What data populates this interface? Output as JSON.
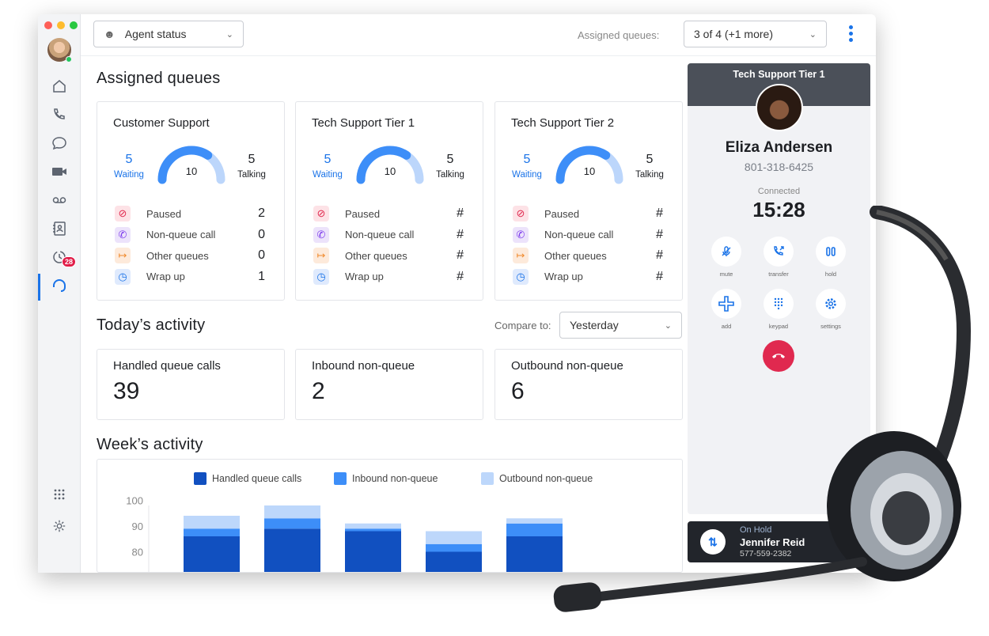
{
  "sidebar": {
    "items": [
      "home",
      "calls",
      "messages",
      "video",
      "voicemail",
      "contacts",
      "history",
      "queues"
    ],
    "history_badge": "28",
    "bottom": [
      "apps",
      "settings"
    ]
  },
  "header": {
    "agent_status": "Agent status",
    "assigned_label": "Assigned queues:",
    "assigned_value": "3 of 4 (+1 more)"
  },
  "assigned": {
    "title": "Assigned queues",
    "queues": [
      {
        "name": "Customer Support",
        "waiting": "5",
        "waiting_label": "Waiting",
        "total": "10",
        "talking": "5",
        "talking_label": "Talking",
        "rows": [
          {
            "label": "Paused",
            "value": "2"
          },
          {
            "label": "Non-queue call",
            "value": "0"
          },
          {
            "label": "Other queues",
            "value": "0"
          },
          {
            "label": "Wrap up",
            "value": "1"
          }
        ]
      },
      {
        "name": "Tech Support Tier 1",
        "waiting": "5",
        "waiting_label": "Waiting",
        "total": "10",
        "talking": "5",
        "talking_label": "Talking",
        "rows": [
          {
            "label": "Paused",
            "value": "#"
          },
          {
            "label": "Non-queue call",
            "value": "#"
          },
          {
            "label": "Other queues",
            "value": "#"
          },
          {
            "label": "Wrap up",
            "value": "#"
          }
        ]
      },
      {
        "name": "Tech Support Tier 2",
        "waiting": "5",
        "waiting_label": "Waiting",
        "total": "10",
        "talking": "5",
        "talking_label": "Talking",
        "rows": [
          {
            "label": "Paused",
            "value": "#"
          },
          {
            "label": "Non-queue call",
            "value": "#"
          },
          {
            "label": "Other queues",
            "value": "#"
          },
          {
            "label": "Wrap up",
            "value": "#"
          }
        ]
      }
    ]
  },
  "today": {
    "title": "Today’s activity",
    "compare_label": "Compare to:",
    "compare_value": "Yesterday",
    "cards": [
      {
        "label": "Handled queue calls",
        "value": "39"
      },
      {
        "label": "Inbound non-queue",
        "value": "2"
      },
      {
        "label": "Outbound non-queue",
        "value": "6"
      }
    ]
  },
  "week": {
    "title": "Week’s activity"
  },
  "chart_data": {
    "type": "bar",
    "stacked": true,
    "title": "",
    "xlabel": "",
    "ylabel": "",
    "ylim_visible": [
      77,
      100
    ],
    "yticks": [
      "100",
      "90",
      "80"
    ],
    "legend": "top",
    "series": [
      {
        "name": "Handled queue calls",
        "color": "#1150c0",
        "values": [
          86,
          89,
          88,
          80,
          86
        ]
      },
      {
        "name": "Inbound non-queue",
        "color": "#3d8ef8",
        "values": [
          3,
          4,
          1,
          3,
          5
        ]
      },
      {
        "name": "Outbound non-queue",
        "color": "#bdd7fb",
        "values": [
          5,
          5,
          2,
          5,
          2
        ]
      }
    ]
  },
  "call": {
    "queue": "Tech Support Tier 1",
    "name": "Eliza Andersen",
    "phone": "801-318-6425",
    "status": "Connected",
    "timer": "15:28",
    "buttons": [
      "mute",
      "transfer",
      "hold",
      "add",
      "keypad",
      "settings"
    ]
  },
  "on_hold": {
    "label": "On Hold",
    "name": "Jennifer Reid",
    "phone": "577-559-2382"
  },
  "colors": {
    "accent": "#1a73e8",
    "end_call": "#e0294f"
  }
}
